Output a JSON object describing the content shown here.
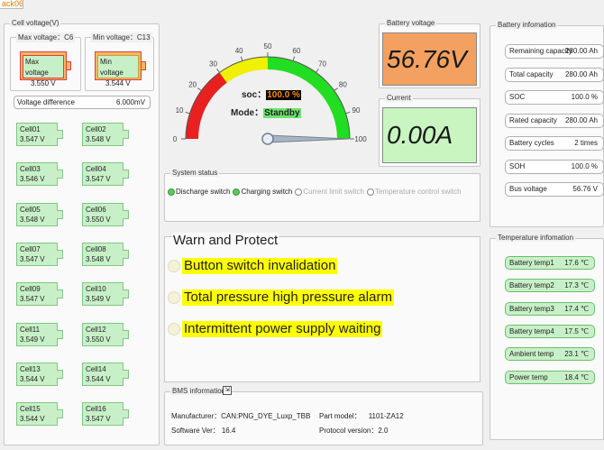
{
  "window": {
    "tab_label": "ack06"
  },
  "cell_voltage": {
    "title": "Cell voltage(V)",
    "max_label": "Max voltage：C6",
    "max_box_label": "Max voltage",
    "max_value": "3.550 V",
    "min_label": "Min voltage：C13",
    "min_box_label": "Min voltage",
    "min_value": "3.544 V",
    "diff_label": "Voltage difference",
    "diff_value": "6.000mV",
    "cells": [
      {
        "name": "Cell01",
        "value": "3.547 V"
      },
      {
        "name": "Cell02",
        "value": "3.548 V"
      },
      {
        "name": "Cell03",
        "value": "3.546 V"
      },
      {
        "name": "Cell04",
        "value": "3.547 V"
      },
      {
        "name": "Cell05",
        "value": "3.548 V"
      },
      {
        "name": "Cell06",
        "value": "3.550 V"
      },
      {
        "name": "Cell07",
        "value": "3.547 V"
      },
      {
        "name": "Cell08",
        "value": "3.548 V"
      },
      {
        "name": "Cell09",
        "value": "3.547 V"
      },
      {
        "name": "Cell10",
        "value": "3.549 V"
      },
      {
        "name": "Cell11",
        "value": "3.549 V"
      },
      {
        "name": "Cell12",
        "value": "3.550 V"
      },
      {
        "name": "Cell13",
        "value": "3.544 V"
      },
      {
        "name": "Cell14",
        "value": "3.544 V"
      },
      {
        "name": "Cell15",
        "value": "3.544 V"
      },
      {
        "name": "Cell16",
        "value": "3.547 V"
      }
    ]
  },
  "gauge": {
    "ticks": [
      "0",
      "10",
      "20",
      "30",
      "40",
      "50",
      "60",
      "70",
      "80",
      "90",
      "100"
    ],
    "soc_label": "soc：",
    "soc_value": "100.0 %",
    "soc_fraction": 1.0,
    "mode_label": "Mode：",
    "mode_value": "Standby",
    "colors": {
      "red": "#e82020",
      "yellow": "#f0f000",
      "green": "#22dd22"
    }
  },
  "battery_voltage": {
    "title": "Battery voltage",
    "value": "56.76V",
    "bg": "#f4a060"
  },
  "current": {
    "title": "Current",
    "value": "0.00A",
    "bg": "#c8f5c0"
  },
  "battery_info": {
    "title": "Battery infomation",
    "rows": [
      {
        "label": "Remaining capacity",
        "value": "280.00 Ah"
      },
      {
        "label": "Total capacity",
        "value": "280.00 Ah"
      },
      {
        "label": "SOC",
        "value": "100.0 %"
      },
      {
        "label": "Rated capacity",
        "value": "280.00 Ah"
      },
      {
        "label": "Battery cycles",
        "value": "2 times"
      },
      {
        "label": "SOH",
        "value": "100.0 %"
      },
      {
        "label": "Bus voltage",
        "value": "56.76 V"
      }
    ]
  },
  "temperature_info": {
    "title": "Temperature infomation",
    "rows": [
      {
        "label": "Battery temp1",
        "value": "17.6 ℃"
      },
      {
        "label": "Battery temp2",
        "value": "17.3 ℃"
      },
      {
        "label": "Battery temp3",
        "value": "17.4 ℃"
      },
      {
        "label": "Battery temp4",
        "value": "17.5 ℃"
      },
      {
        "label": "Ambient temp",
        "value": "23.1 ℃"
      },
      {
        "label": "Power temp",
        "value": "18.4 ℃"
      }
    ]
  },
  "system_status": {
    "title": "System status",
    "switches": [
      {
        "label": "Discharge switch",
        "on": true
      },
      {
        "label": "Charging switch",
        "on": true
      },
      {
        "label": "Current limit switch",
        "on": false
      },
      {
        "label": "Temperature control switch",
        "on": false
      }
    ]
  },
  "warn": {
    "title": "Warn and Protect",
    "items": [
      "Button switch invalidation",
      "Total pressure high pressure alarm",
      "Intermittent power supply waiting"
    ]
  },
  "bms": {
    "title": "BMS information",
    "manufacturer_label": "Manufacturer：",
    "manufacturer_value": "CAN:PNG_DYE_Luxp_TBB",
    "part_label": "Part model：",
    "part_value": "1101-ZA12",
    "software_label": "Software Ver：",
    "software_value": "16.4",
    "protocol_label": "Protocol version：",
    "protocol_value": "2.0"
  }
}
